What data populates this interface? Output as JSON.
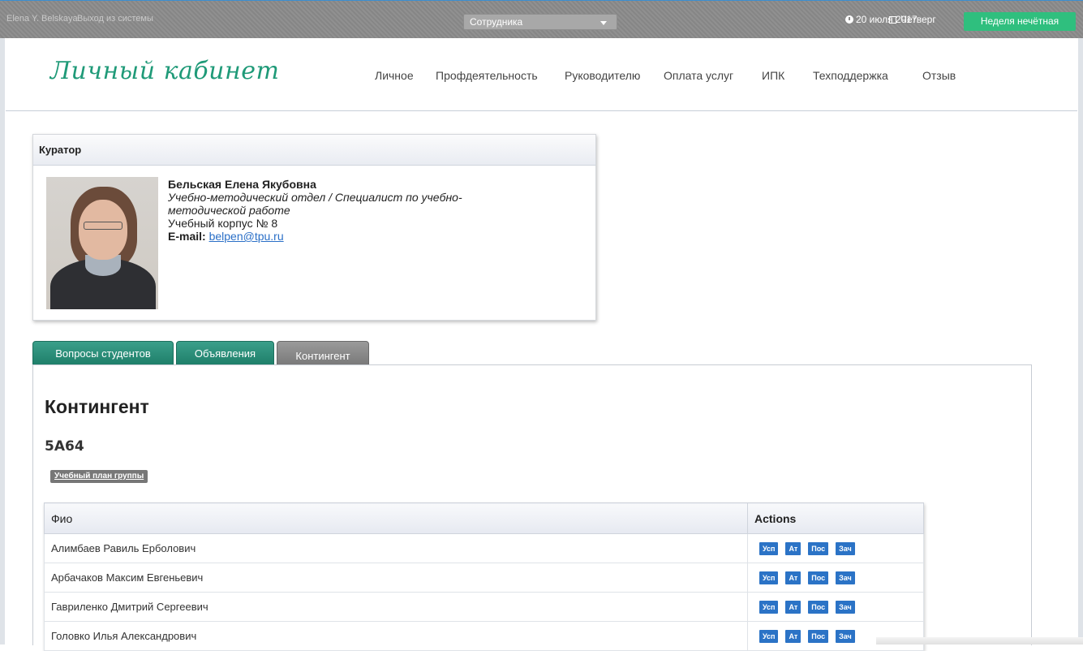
{
  "topbar": {
    "user": "Elena Y. Belskaya",
    "logout": "Выход из системы",
    "role_select": "Сотрудника",
    "date": "20 июля 2017",
    "weekday": "Четверг",
    "week_type": "Неделя нечётная"
  },
  "header": {
    "logo": "Личный кабинет",
    "nav": [
      "Личное",
      "Профдеятельность",
      "Руководителю",
      "Оплата услуг",
      "ИПК",
      "Техподдержка",
      "Отзыв"
    ]
  },
  "curator": {
    "title": "Куратор",
    "name": "Бельская Елена Якубовна",
    "dept_line1": "Учебно-методический отдел / Специалист по учебно-",
    "dept_line2": "методической работе",
    "building": "Учебный корпус № 8",
    "email_label": "E-mail:",
    "email": "belpen@tpu.ru"
  },
  "tabs": [
    "Вопросы студентов",
    "Объявления",
    "Контингент"
  ],
  "content": {
    "heading": "Контингент",
    "group": "5А64",
    "plan_button": "Учебный план группы",
    "table": {
      "col_name": "Фио",
      "col_actions": "Actions",
      "action_labels": [
        "Усп",
        "Ат",
        "Пос",
        "Зач"
      ],
      "rows": [
        "Алимбаев Равиль Ерболович",
        "Арбачаков Максим Евгеньевич",
        "Гавриленко Дмитрий Сергеевич",
        "Головко Илья Александрович"
      ]
    }
  },
  "colors": {
    "accent_green": "#1f9a78",
    "week_badge": "#2fbf7e",
    "action_blue": "#2b73c6",
    "topbar_gray": "#8a8a8a"
  }
}
